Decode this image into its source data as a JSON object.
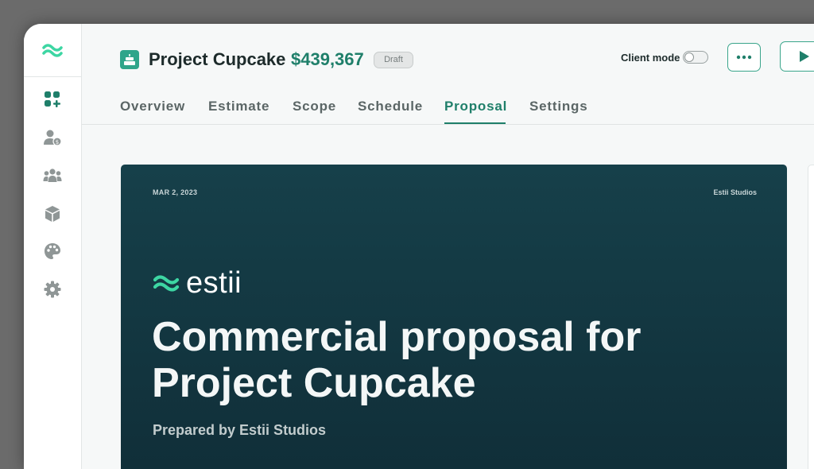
{
  "header": {
    "project_title": "Project Cupcake",
    "price": "$439,367",
    "status_badge": "Draft",
    "client_mode_label": "Client mode",
    "client_mode_on": false
  },
  "tabs": [
    {
      "label": "Overview",
      "active": false
    },
    {
      "label": "Estimate",
      "active": false
    },
    {
      "label": "Scope",
      "active": false
    },
    {
      "label": "Schedule",
      "active": false
    },
    {
      "label": "Proposal",
      "active": true
    },
    {
      "label": "Settings",
      "active": false
    }
  ],
  "sidebar": {
    "icons": [
      "logo-waves-icon",
      "dashboard-add-icon",
      "user-billing-icon",
      "team-icon",
      "package-box-icon",
      "palette-icon",
      "gear-icon"
    ]
  },
  "proposal": {
    "date": "MAR 2, 2023",
    "studio": "Estii Studios",
    "brand": "estii",
    "heading": "Commercial proposal for Project Cupcake",
    "subheading": "Prepared by Estii Studios"
  },
  "colors": {
    "accent": "#1f7f6a",
    "brand_green": "#3dd6a3",
    "card_dark": "#12343e"
  }
}
